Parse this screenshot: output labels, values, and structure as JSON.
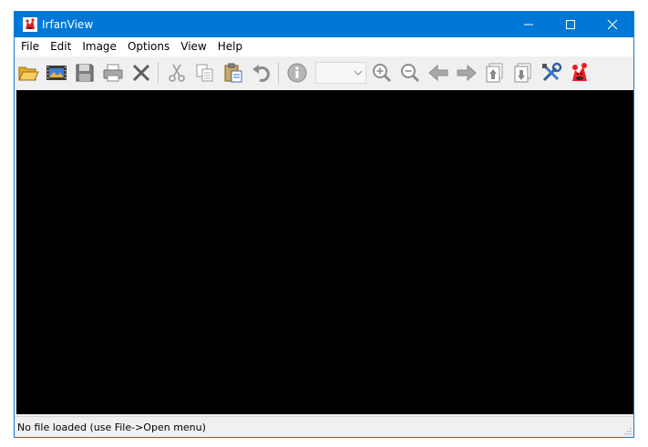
{
  "window": {
    "title": "IrfanView",
    "icon": "irfanview-logo-icon"
  },
  "titlebar": {
    "buttons": [
      "minimize-icon",
      "maximize-icon",
      "close-icon"
    ]
  },
  "menu": {
    "items": [
      "File",
      "Edit",
      "Image",
      "Options",
      "View",
      "Help"
    ]
  },
  "toolbar": {
    "buttons": [
      "open-folder-icon",
      "slideshow-icon",
      "save-icon",
      "print-icon",
      "delete-icon",
      "cut-icon",
      "copy-icon",
      "paste-icon",
      "undo-icon",
      "info-icon",
      "zoom-in-icon",
      "zoom-out-icon",
      "previous-icon",
      "next-icon",
      "page-up-icon",
      "page-down-icon",
      "settings-icon",
      "irfanview-about-icon"
    ],
    "zoom": {
      "value": ""
    }
  },
  "canvas": {
    "background": "#000000"
  },
  "status": {
    "text": "No file loaded (use File->Open menu)"
  },
  "colors": {
    "titlebar": "#0078d7",
    "accent": "#ee1c25"
  }
}
